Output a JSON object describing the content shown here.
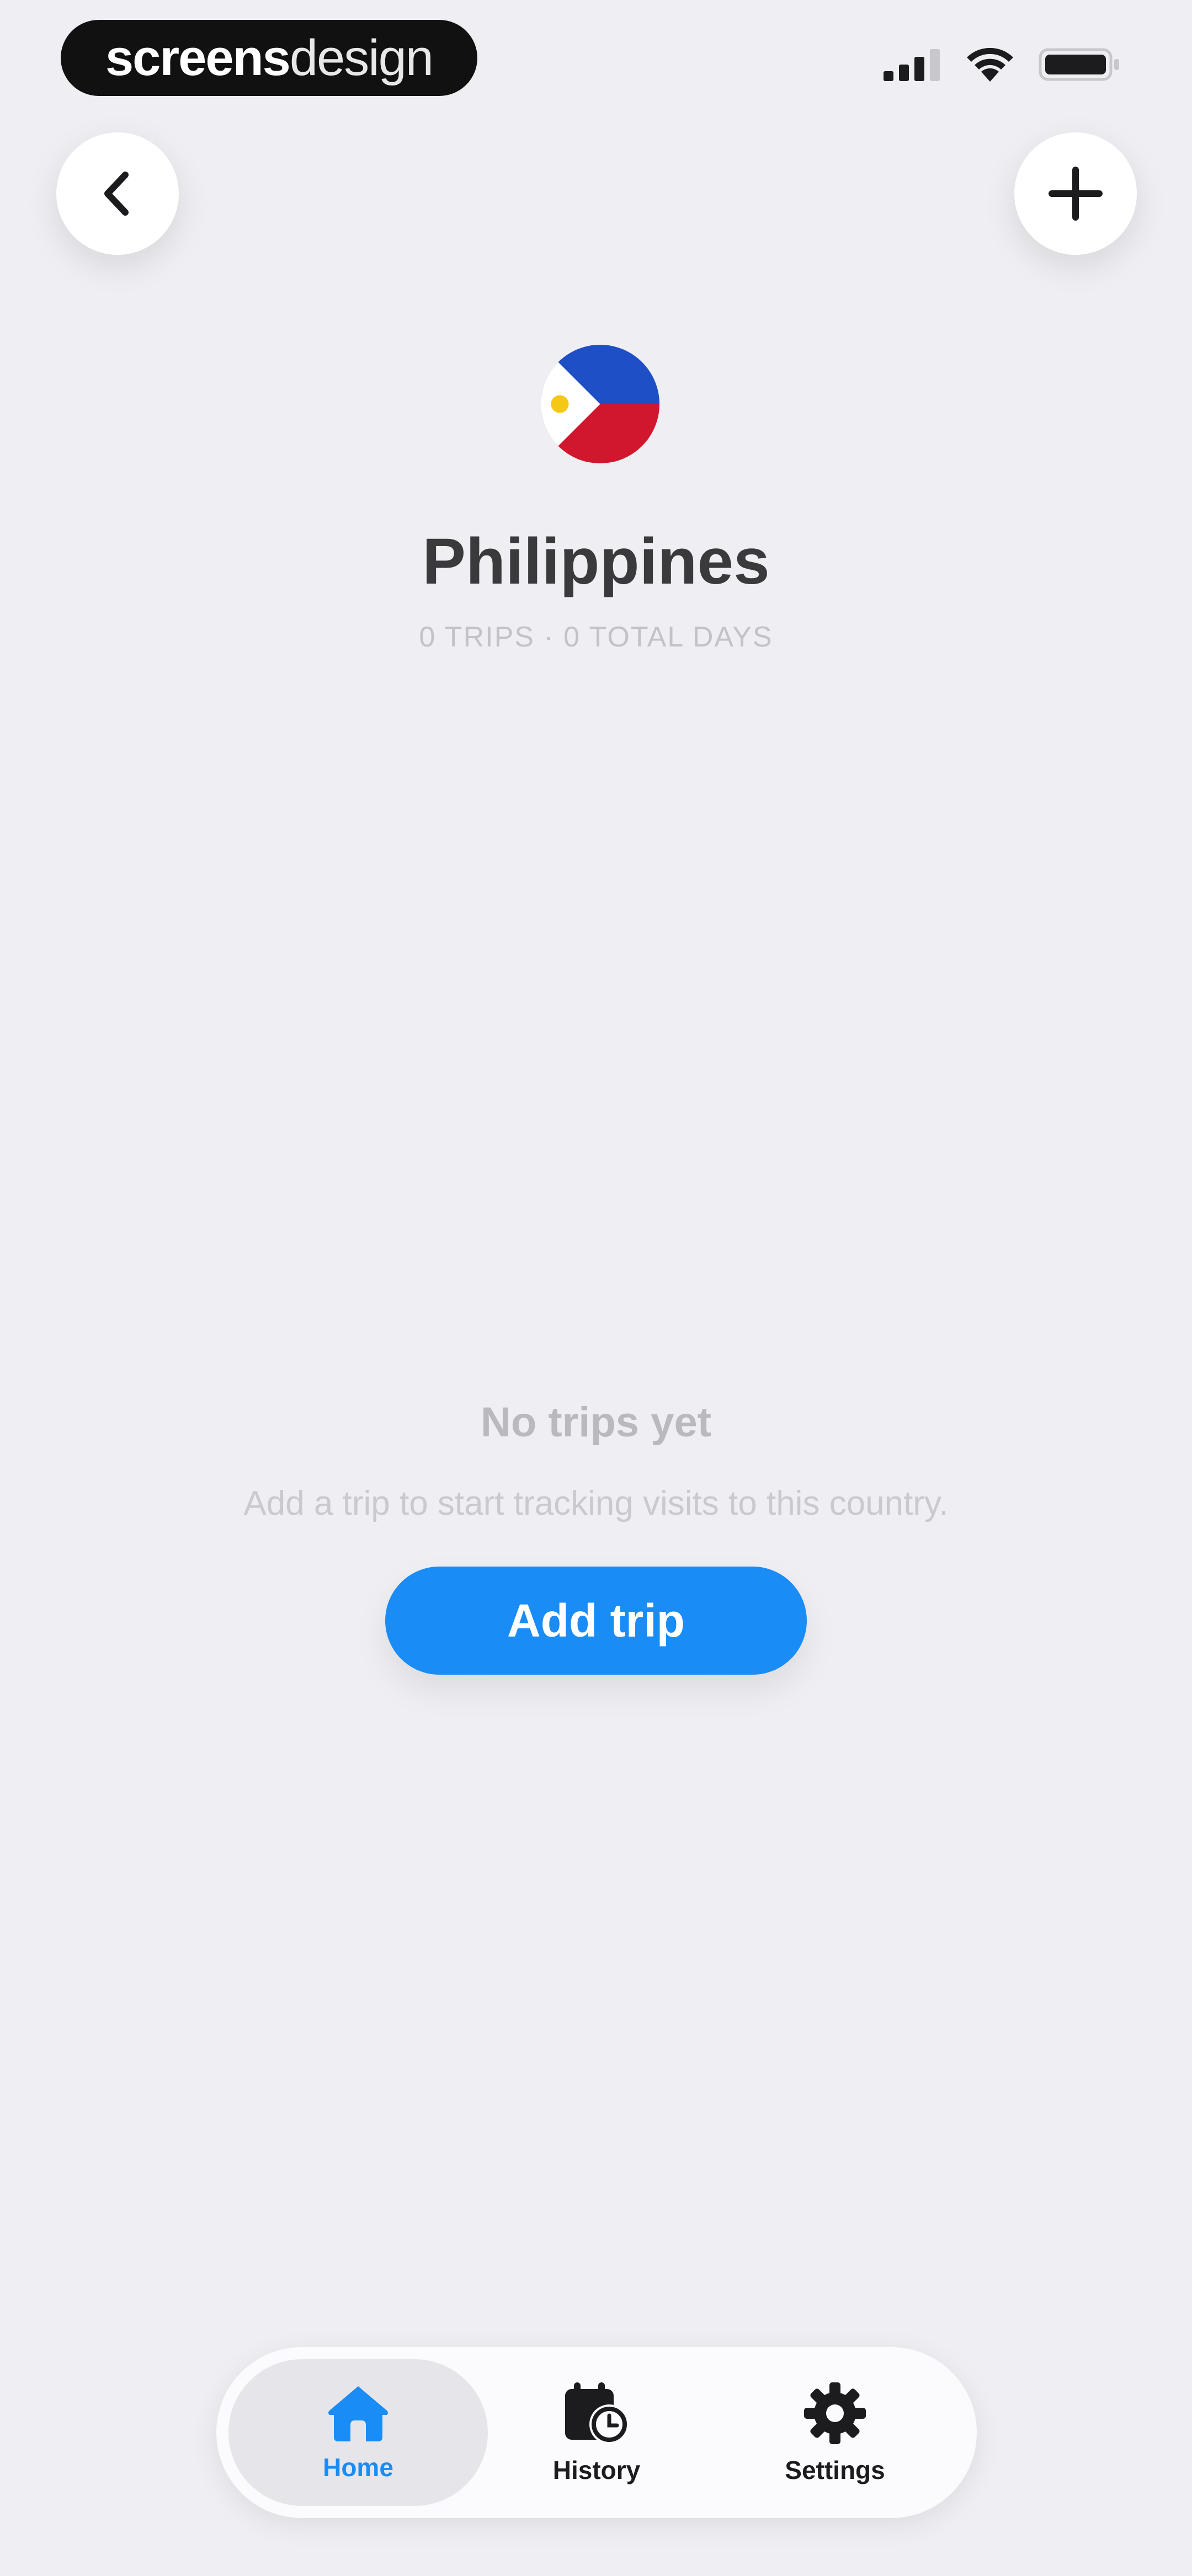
{
  "status_bar": {
    "brand_bold": "screens",
    "brand_light": "design",
    "icons": [
      "signal-icon",
      "wifi-icon",
      "battery-icon"
    ]
  },
  "header": {
    "back_icon": "chevron-left-icon",
    "add_icon": "plus-icon",
    "flag_icon": "philippines-flag-icon",
    "country": "Philippines",
    "subtitle": "0 TRIPS · 0 TOTAL DAYS"
  },
  "empty_state": {
    "title": "No trips yet",
    "description": "Add a trip to start tracking visits to this country.",
    "button_label": "Add trip"
  },
  "tab_bar": {
    "tabs": [
      {
        "label": "Home",
        "icon": "home-icon",
        "active": true
      },
      {
        "label": "History",
        "icon": "calendar-clock-icon",
        "active": false
      },
      {
        "label": "Settings",
        "icon": "gear-icon",
        "active": false
      }
    ]
  },
  "colors": {
    "accent": "#1a8cf5",
    "background": "#efeff3",
    "flag_blue": "#1f4fc4",
    "flag_red": "#d1172d",
    "flag_sun": "#f5c816"
  }
}
